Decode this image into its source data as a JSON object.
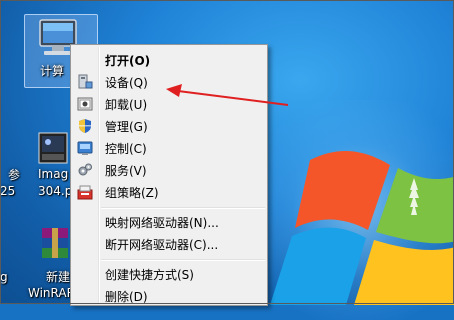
{
  "desktop": {
    "icons": [
      {
        "label": "计算"
      },
      {
        "label": "参"
      },
      {
        "label": "25"
      },
      {
        "label": "Imag"
      },
      {
        "label": "304.p"
      },
      {
        "label": "新建"
      },
      {
        "label": "WinRAR"
      },
      {
        "label": "g"
      }
    ]
  },
  "context_menu": {
    "items": [
      {
        "label": "打开(O)"
      },
      {
        "label": "设备(Q)"
      },
      {
        "label": "卸载(U)"
      },
      {
        "label": "管理(G)"
      },
      {
        "label": "控制(C)"
      },
      {
        "label": "服务(V)"
      },
      {
        "label": "组策略(Z)"
      },
      {
        "label": "映射网络驱动器(N)..."
      },
      {
        "label": "断开网络驱动器(C)..."
      },
      {
        "label": "创建快捷方式(S)"
      },
      {
        "label": "删除(D)"
      }
    ]
  },
  "colors": {
    "annotation_arrow": "#e02020",
    "menu_bg": "#f0f0f0"
  }
}
